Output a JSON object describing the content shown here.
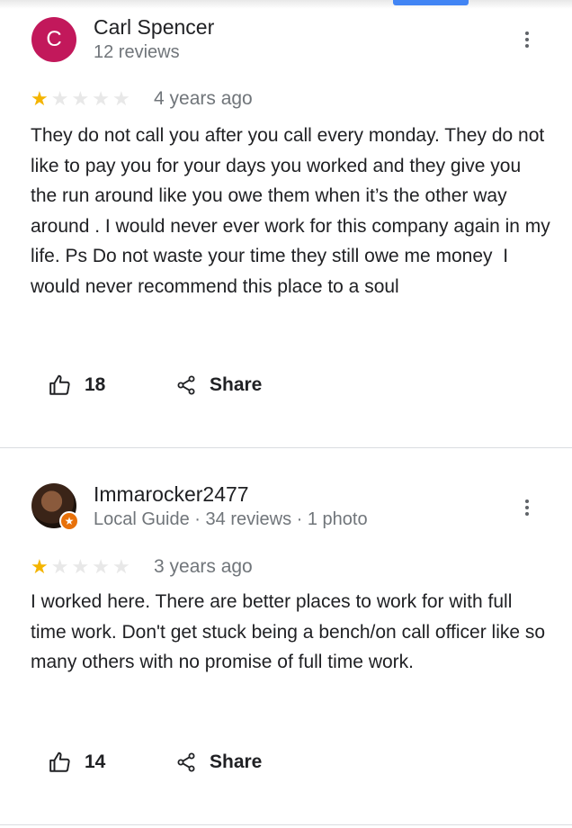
{
  "reviews": [
    {
      "author": "Carl Spencer",
      "avatar_letter": "C",
      "meta": "12 reviews",
      "rating": 1,
      "date": "4 years ago",
      "text": "They do not call you after you call every monday. They do not like to pay you for your days you worked and they give you the run around like you owe them when it’s the other way around . I would never ever work for this company again in my life. Ps Do not waste your time they still owe me money  I would never recommend this place to a soul",
      "likes": "18",
      "share_label": "Share"
    },
    {
      "author": "Immarocker2477",
      "badge_icon": "local-guide-star-icon",
      "meta": "Local Guide · 34 reviews · 1 photo",
      "rating": 1,
      "date": "3 years ago",
      "text": "I worked here. There are better places to work for with full time work. Don't get stuck being a bench/on call officer like so many others with no promise of full time work.",
      "likes": "14",
      "share_label": "Share"
    }
  ],
  "colors": {
    "accent": "#4285f4",
    "star": "#f4b400",
    "avatar_c": "#c2185b",
    "badge": "#e8710a"
  }
}
